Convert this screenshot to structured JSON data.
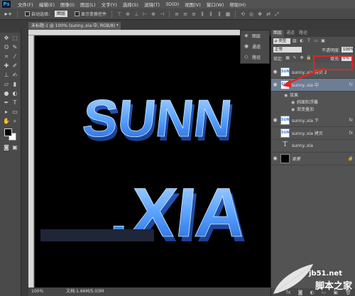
{
  "app": {
    "logo": "Ps"
  },
  "menu": [
    "文件(F)",
    "编辑(E)",
    "图像(I)",
    "图层(L)",
    "文字(Y)",
    "选择(S)",
    "滤镜(T)",
    "3D(D)",
    "视图(V)",
    "窗口(W)",
    "帮助(H)"
  ],
  "options": {
    "auto_select_label": "自动选择：",
    "auto_select_value": "图层",
    "show_transform_label": "显示变换控件"
  },
  "document": {
    "tab_title": "未标题-1 @ 100% (sunny..xia 中, RGB/8) *",
    "canvas_text_line1": "SUNN",
    "canvas_text_line2": ".XIA",
    "status_zoom": "100%",
    "status_doc": "文档:1.66M/5.03M"
  },
  "mini_panel": {
    "items": [
      {
        "label": "图层",
        "icon": "layers-icon"
      },
      {
        "label": "通道",
        "icon": "channels-icon"
      },
      {
        "label": "路径",
        "icon": "paths-icon"
      }
    ]
  },
  "layers_panel": {
    "tabs": [
      "图层",
      "通道",
      "路径"
    ],
    "filter_kind": "ρ 类型",
    "blend_mode": "正常",
    "opacity_label": "不透明度:",
    "opacity_value": "100%",
    "lock_label": "锁定:",
    "fill_label": "填充:",
    "fill_value": "0%",
    "layers": [
      {
        "name": "sunny..xia 拷贝 2",
        "thumb": "SUN",
        "selected": false,
        "fx": ""
      },
      {
        "name": "sunny..xia 中",
        "thumb": "SUN",
        "selected": true,
        "fx": "fx"
      },
      {
        "name": "sunny..xia 下",
        "thumb": "SUN",
        "selected": false,
        "fx": "fx"
      },
      {
        "name": "sunny..xia 拷贝",
        "thumb": "SUN",
        "selected": false,
        "fx": "fx"
      },
      {
        "name": "sunny..xia",
        "thumb": "T",
        "selected": false,
        "fx": ""
      },
      {
        "name": "背景",
        "thumb": "",
        "selected": false,
        "fx": ""
      }
    ],
    "effects_label": "效果",
    "effects": [
      "斜面和浮雕",
      "渐变叠加"
    ]
  },
  "watermark": {
    "domain": "jb51.net",
    "name": "脚本之家"
  },
  "colors": {
    "text_gradient_top": "#9ccbff",
    "text_gradient_bottom": "#2a6fe0",
    "highlight": "#e32424",
    "selected_layer": "#6d7d94"
  }
}
